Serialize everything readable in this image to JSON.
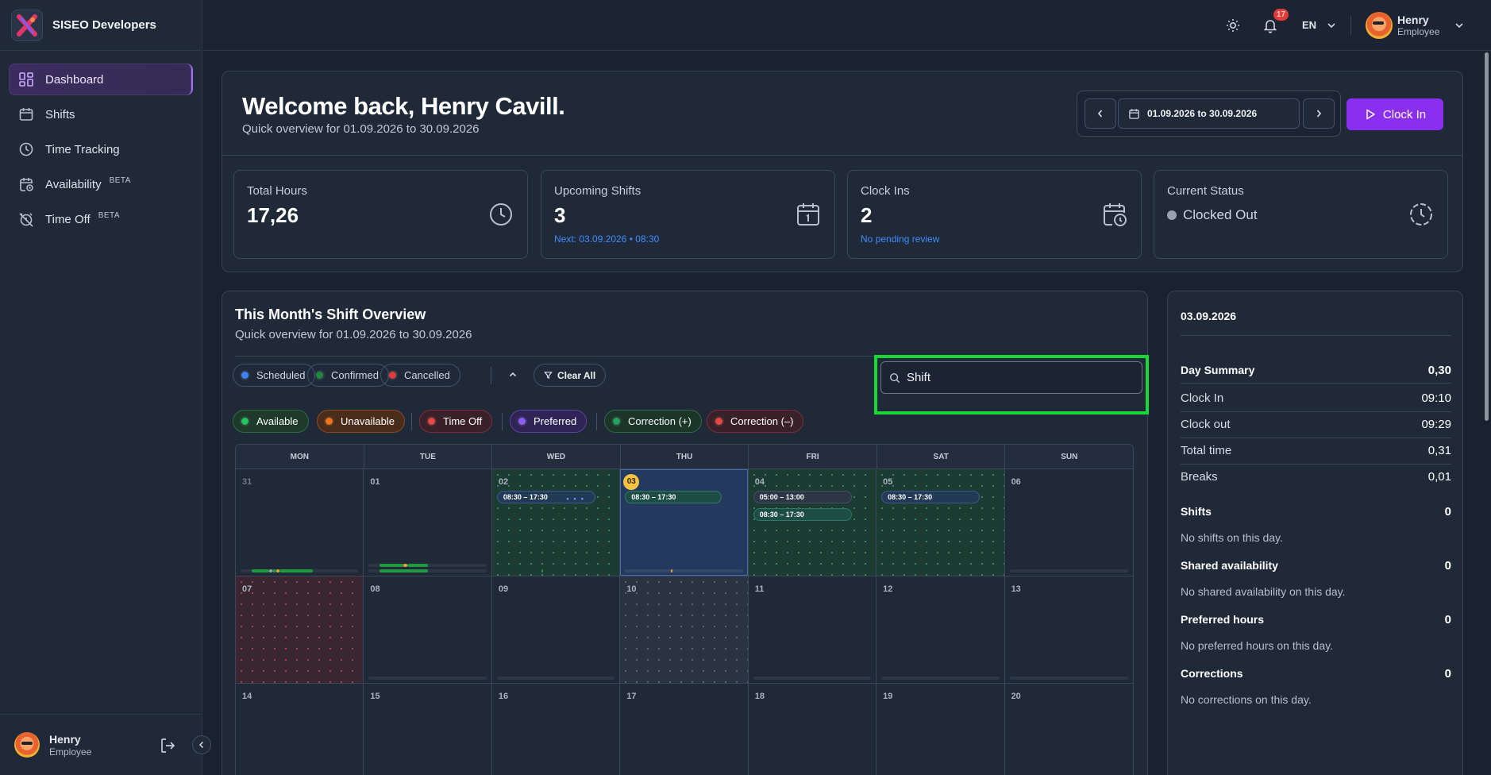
{
  "brand": {
    "name": "SISEO Developers"
  },
  "sidebar": {
    "items": [
      {
        "label": "Dashboard",
        "badge": ""
      },
      {
        "label": "Shifts",
        "badge": ""
      },
      {
        "label": "Time Tracking",
        "badge": ""
      },
      {
        "label": "Availability",
        "badge": "BETA"
      },
      {
        "label": "Time Off",
        "badge": "BETA"
      }
    ],
    "user": {
      "name": "Henry",
      "role": "Employee"
    }
  },
  "topbar": {
    "notifications": "17",
    "language": "EN",
    "user": {
      "name": "Henry",
      "role": "Employee"
    }
  },
  "welcome": {
    "title": "Welcome back, Henry Cavill.",
    "subtitle": "Quick overview for 01.09.2026 to 30.09.2026",
    "range": "01.09.2026 to 30.09.2026",
    "clock_in_label": "Clock In"
  },
  "stats": [
    {
      "label": "Total Hours",
      "value": "17,26",
      "note": ""
    },
    {
      "label": "Upcoming Shifts",
      "value": "3",
      "note": "Next: 03.09.2026 • 08:30"
    },
    {
      "label": "Clock Ins",
      "value": "2",
      "note": "No pending review"
    },
    {
      "label": "Current Status",
      "value": "Clocked Out",
      "note": ""
    }
  ],
  "overview": {
    "title": "This Month's Shift Overview",
    "subtitle": "Quick overview for 01.09.2026 to 30.09.2026",
    "search_value": "Shift",
    "status_filters": [
      "Scheduled",
      "Confirmed",
      "Cancelled"
    ],
    "clear_all": "Clear All",
    "type_filters": [
      "Available",
      "Unavailable",
      "Time Off",
      "Preferred",
      "Correction (+)",
      "Correction (–)"
    ],
    "filter_colors": {
      "Scheduled": "#3b82f6",
      "Confirmed": "#1f8a3c",
      "Cancelled": "#e23b3b",
      "Available": "#22c55e",
      "Unavailable": "#f97316",
      "Time Off": "#ef4444",
      "Preferred": "#8b5cf6",
      "Correction (+)": "#22a55e",
      "Correction (–)": "#ef4444"
    },
    "weekdays": [
      "MON",
      "TUE",
      "WED",
      "THU",
      "FRI",
      "SAT",
      "SUN"
    ],
    "days": [
      {
        "d": "31",
        "shifts": []
      },
      {
        "d": "01",
        "shifts": []
      },
      {
        "d": "02",
        "shifts": [
          "08:30 – 17:30"
        ]
      },
      {
        "d": "03",
        "shifts": [
          "08:30 – 17:30"
        ]
      },
      {
        "d": "04",
        "shifts": [
          "05:00 – 13:00",
          "08:30 – 17:30"
        ]
      },
      {
        "d": "05",
        "shifts": [
          "08:30 – 17:30"
        ]
      },
      {
        "d": "06",
        "shifts": []
      },
      {
        "d": "07",
        "shifts": []
      },
      {
        "d": "08",
        "shifts": []
      },
      {
        "d": "09",
        "shifts": []
      },
      {
        "d": "10",
        "shifts": []
      },
      {
        "d": "11",
        "shifts": []
      },
      {
        "d": "12",
        "shifts": []
      },
      {
        "d": "13",
        "shifts": []
      },
      {
        "d": "14",
        "shifts": []
      },
      {
        "d": "15",
        "shifts": []
      },
      {
        "d": "16",
        "shifts": []
      },
      {
        "d": "17",
        "shifts": []
      },
      {
        "d": "18",
        "shifts": []
      },
      {
        "d": "19",
        "shifts": []
      },
      {
        "d": "20",
        "shifts": []
      }
    ]
  },
  "summary": {
    "date": "03.09.2026",
    "day_summary": {
      "label": "Day Summary",
      "value": "0,30"
    },
    "rows": [
      {
        "label": "Clock In",
        "value": "09:10"
      },
      {
        "label": "Clock out",
        "value": "09:29"
      },
      {
        "label": "Total time",
        "value": "0,31"
      },
      {
        "label": "Breaks",
        "value": "0,01"
      }
    ],
    "sections": [
      {
        "label": "Shifts",
        "count": "0",
        "note": "No shifts on this day."
      },
      {
        "label": "Shared availability",
        "count": "0",
        "note": "No shared availability on this day."
      },
      {
        "label": "Preferred hours",
        "count": "0",
        "note": "No preferred hours on this day."
      },
      {
        "label": "Corrections",
        "count": "0",
        "note": "No corrections on this day."
      }
    ]
  }
}
